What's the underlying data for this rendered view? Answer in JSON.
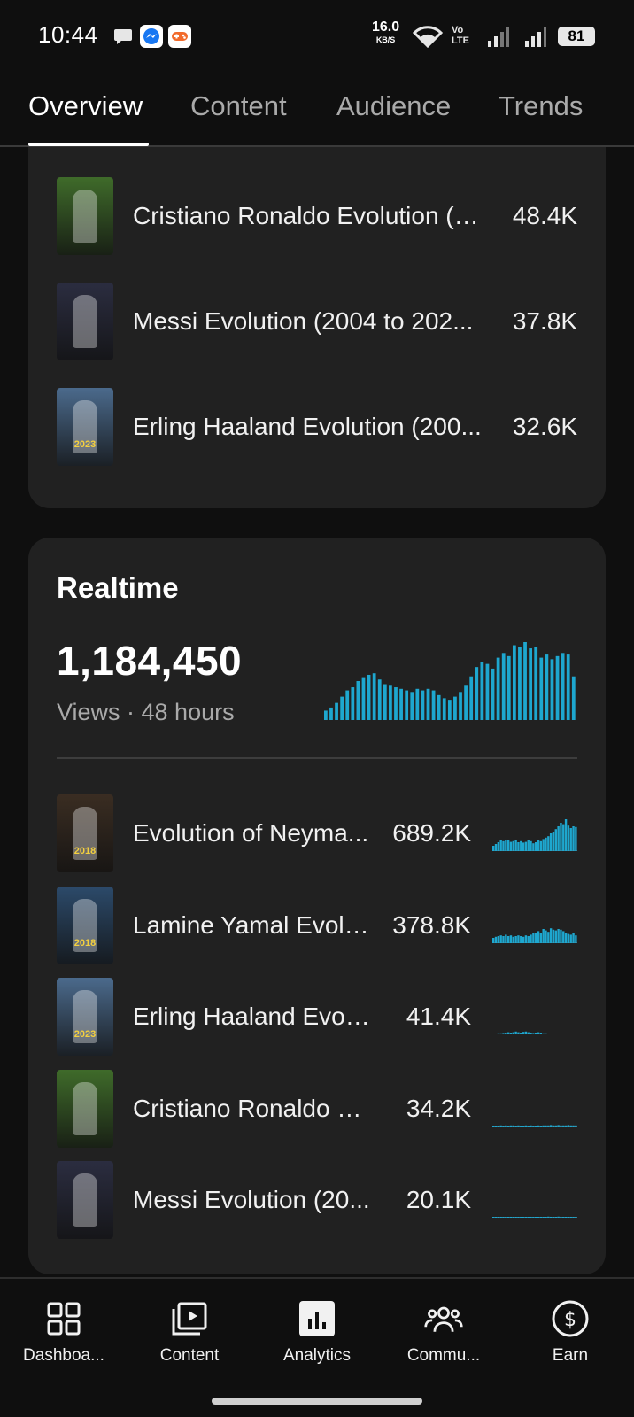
{
  "status_bar": {
    "time": "10:44",
    "speed_value": "16.0",
    "speed_unit": "KB/S",
    "battery": "81",
    "icons": [
      "chat-icon",
      "messenger-icon",
      "game-icon",
      "wifi-icon",
      "volte-icon",
      "signal-icon",
      "signal-icon",
      "battery-icon"
    ]
  },
  "tabs": [
    {
      "label": "Overview",
      "active": true
    },
    {
      "label": "Content",
      "active": false
    },
    {
      "label": "Audience",
      "active": false
    },
    {
      "label": "Trends",
      "active": false
    }
  ],
  "top_content": [
    {
      "title": "Cristiano Ronaldo Evolution (1...",
      "value": "48.4K",
      "thumb_color": "#3f6b2a",
      "badge": ""
    },
    {
      "title": "Messi Evolution (2004 to 202...",
      "value": "37.8K",
      "thumb_color": "#2b2d40",
      "badge": ""
    },
    {
      "title": "Erling Haaland Evolution (200...",
      "value": "32.6K",
      "thumb_color": "#4b6a8c",
      "badge": "2023"
    }
  ],
  "realtime": {
    "title": "Realtime",
    "total": "1,184,450",
    "subtitle": "Views · 48 hours",
    "bars": [
      0.12,
      0.16,
      0.22,
      0.3,
      0.38,
      0.42,
      0.5,
      0.55,
      0.58,
      0.6,
      0.52,
      0.46,
      0.44,
      0.42,
      0.4,
      0.38,
      0.36,
      0.4,
      0.38,
      0.4,
      0.38,
      0.32,
      0.28,
      0.26,
      0.3,
      0.36,
      0.44,
      0.56,
      0.68,
      0.74,
      0.72,
      0.66,
      0.8,
      0.86,
      0.82,
      0.96,
      0.94,
      1.0,
      0.92,
      0.94,
      0.8,
      0.84,
      0.78,
      0.82,
      0.86,
      0.84,
      0.56
    ],
    "accent": "#1ea7cf",
    "items": [
      {
        "title": "Evolution of Neyma...",
        "value": "689.2K",
        "thumb_color": "#3a2d22",
        "badge": "2018",
        "spark": [
          0.15,
          0.2,
          0.25,
          0.3,
          0.28,
          0.32,
          0.3,
          0.26,
          0.28,
          0.3,
          0.25,
          0.28,
          0.24,
          0.26,
          0.3,
          0.28,
          0.22,
          0.25,
          0.3,
          0.28,
          0.34,
          0.38,
          0.42,
          0.5,
          0.55,
          0.62,
          0.7,
          0.8,
          0.76,
          0.9,
          0.72,
          0.65,
          0.7,
          0.68
        ]
      },
      {
        "title": "Lamine Yamal Evolu...",
        "value": "378.8K",
        "thumb_color": "#2c4a6a",
        "badge": "2018",
        "spark": [
          0.15,
          0.18,
          0.2,
          0.22,
          0.2,
          0.24,
          0.2,
          0.22,
          0.18,
          0.2,
          0.22,
          0.2,
          0.18,
          0.22,
          0.2,
          0.24,
          0.3,
          0.28,
          0.34,
          0.3,
          0.4,
          0.36,
          0.32,
          0.42,
          0.38,
          0.36,
          0.4,
          0.38,
          0.34,
          0.3,
          0.26,
          0.24,
          0.3,
          0.22
        ]
      },
      {
        "title": "Erling Haaland Evol...",
        "value": "41.4K",
        "thumb_color": "#4b6a8c",
        "badge": "2023",
        "spark": [
          0.02,
          0.02,
          0.03,
          0.03,
          0.04,
          0.05,
          0.06,
          0.05,
          0.06,
          0.08,
          0.06,
          0.05,
          0.07,
          0.08,
          0.06,
          0.05,
          0.04,
          0.05,
          0.06,
          0.05,
          0.03,
          0.03,
          0.02,
          0.02,
          0.02,
          0.02,
          0.02,
          0.02,
          0.02,
          0.02,
          0.02,
          0.02,
          0.02,
          0.02
        ]
      },
      {
        "title": "Cristiano Ronaldo E...",
        "value": "34.2K",
        "thumb_color": "#3f6b2a",
        "badge": "",
        "spark": [
          0.02,
          0.02,
          0.02,
          0.03,
          0.02,
          0.03,
          0.02,
          0.03,
          0.03,
          0.02,
          0.03,
          0.02,
          0.02,
          0.03,
          0.02,
          0.03,
          0.02,
          0.02,
          0.03,
          0.02,
          0.03,
          0.03,
          0.03,
          0.04,
          0.03,
          0.03,
          0.04,
          0.03,
          0.03,
          0.03,
          0.04,
          0.03,
          0.03,
          0.03
        ]
      },
      {
        "title": "Messi Evolution (20...",
        "value": "20.1K",
        "thumb_color": "#2b2d40",
        "badge": "",
        "spark": [
          0.02,
          0.02,
          0.02,
          0.02,
          0.02,
          0.02,
          0.02,
          0.02,
          0.02,
          0.02,
          0.02,
          0.02,
          0.02,
          0.02,
          0.02,
          0.02,
          0.02,
          0.02,
          0.02,
          0.02,
          0.02,
          0.02,
          0.03,
          0.02,
          0.02,
          0.02,
          0.03,
          0.02,
          0.02,
          0.02,
          0.02,
          0.02,
          0.02,
          0.02
        ]
      }
    ]
  },
  "bottom_nav": [
    {
      "label": "Dashboa...",
      "icon": "dashboard-icon",
      "active": false
    },
    {
      "label": "Content",
      "icon": "content-icon",
      "active": false
    },
    {
      "label": "Analytics",
      "icon": "analytics-icon",
      "active": true
    },
    {
      "label": "Commu...",
      "icon": "community-icon",
      "active": false
    },
    {
      "label": "Earn",
      "icon": "earn-icon",
      "active": false
    }
  ]
}
